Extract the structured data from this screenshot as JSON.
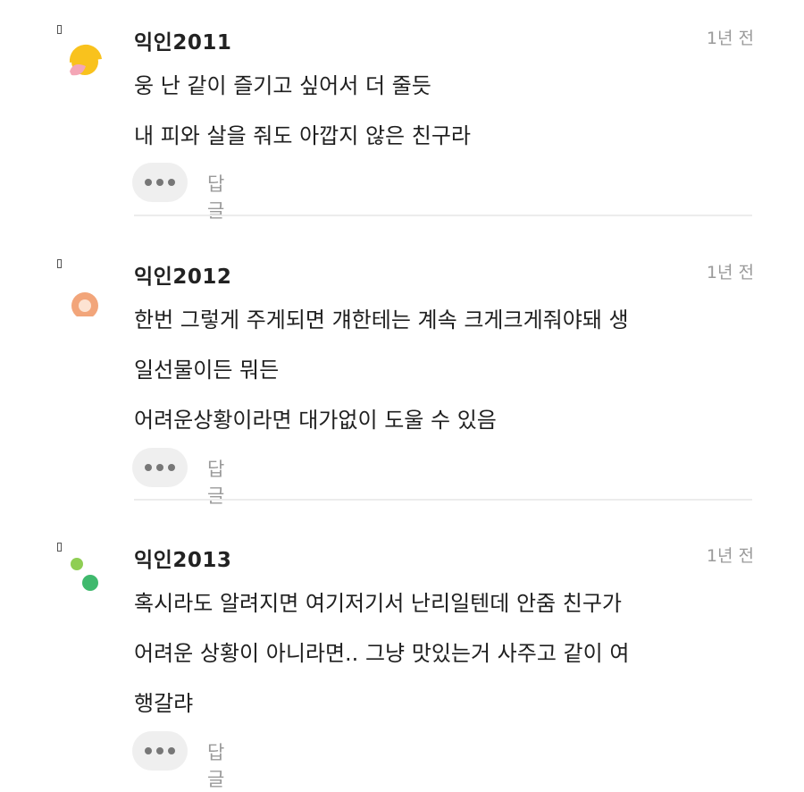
{
  "comments": [
    {
      "author": "익인2011",
      "time": "1년 전",
      "lines": [
        "웅 난 같이 즐기고 싶어서 더 줄듯",
        "내 피와 살을 줘도 아깝지 않은 친구라"
      ],
      "reply_label": "답글",
      "avatar": "sun-avatar-icon",
      "avatar_colors": [
        "#f9c21d",
        "#f4a6b6"
      ]
    },
    {
      "author": "익인2012",
      "time": "1년 전",
      "lines": [
        "한번 그렇게 주게되면 걔한테는 계속 크게크게줘야돼 생",
        "일선물이든 뭐든",
        "어려운상황이라면 대가없이 도울 수 있음"
      ],
      "reply_label": "답글",
      "avatar": "ring-avatar-icon",
      "avatar_colors": [
        "#f2a57a",
        "#fde3d2"
      ]
    },
    {
      "author": "익인2013",
      "time": "1년 전",
      "lines": [
        "혹시라도 알려지면 여기저기서 난리일텐데 안줌 친구가",
        "어려운 상황이 아니라면.. 그냥 맛있는거 사주고 같이 여",
        "행갈랴"
      ],
      "reply_label": "답글",
      "avatar": "dots-avatar-icon",
      "avatar_colors": [
        "#8fce54",
        "#3fb96d"
      ]
    }
  ]
}
